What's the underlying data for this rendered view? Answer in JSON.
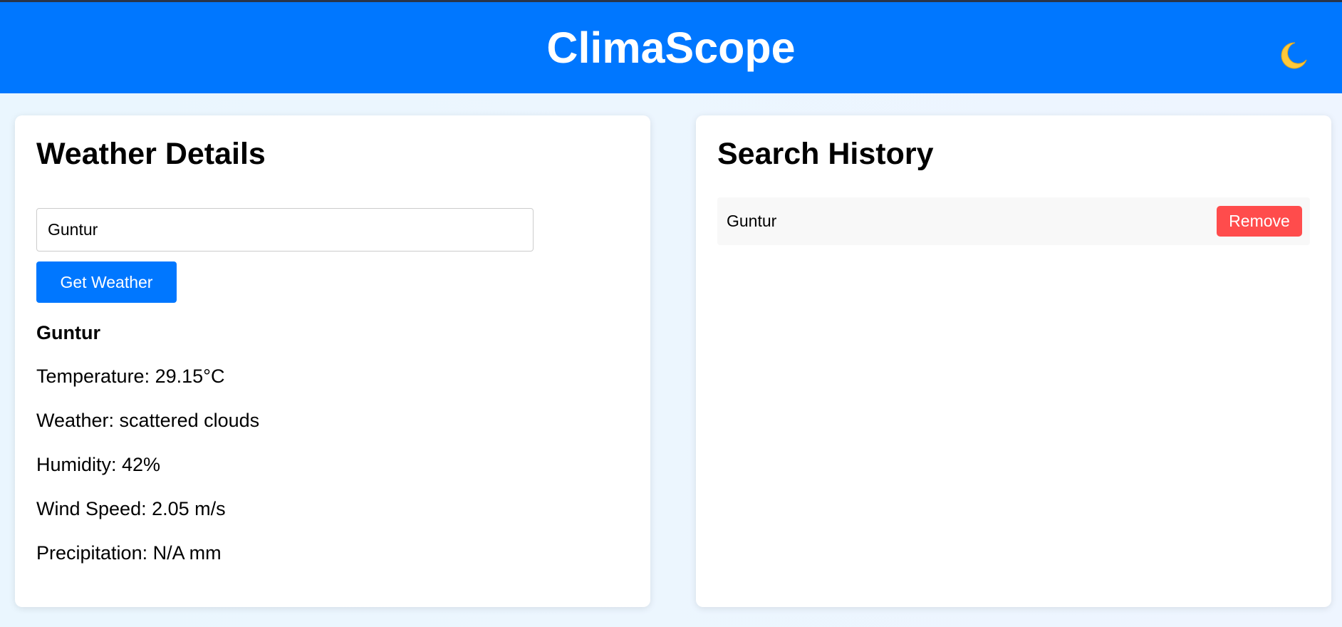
{
  "header": {
    "title": "ClimaScope",
    "theme_toggle_icon": "moon-icon",
    "background_color": "#0077ff"
  },
  "weather": {
    "title": "Weather Details",
    "search_value": "Guntur",
    "button_label": "Get Weather",
    "result": {
      "city": "Guntur",
      "temperature": "Temperature: 29.15°C",
      "condition": "Weather: scattered clouds",
      "humidity": "Humidity: 42%",
      "wind": "Wind Speed: 2.05 m/s",
      "precipitation": "Precipitation: N/A mm"
    }
  },
  "history": {
    "title": "Search History",
    "items": [
      {
        "city": "Guntur",
        "remove_label": "Remove"
      }
    ]
  },
  "colors": {
    "accent": "#0077ff",
    "danger": "#ff4c4c",
    "page_background": "#eaf6fe",
    "card_background": "#ffffff"
  }
}
